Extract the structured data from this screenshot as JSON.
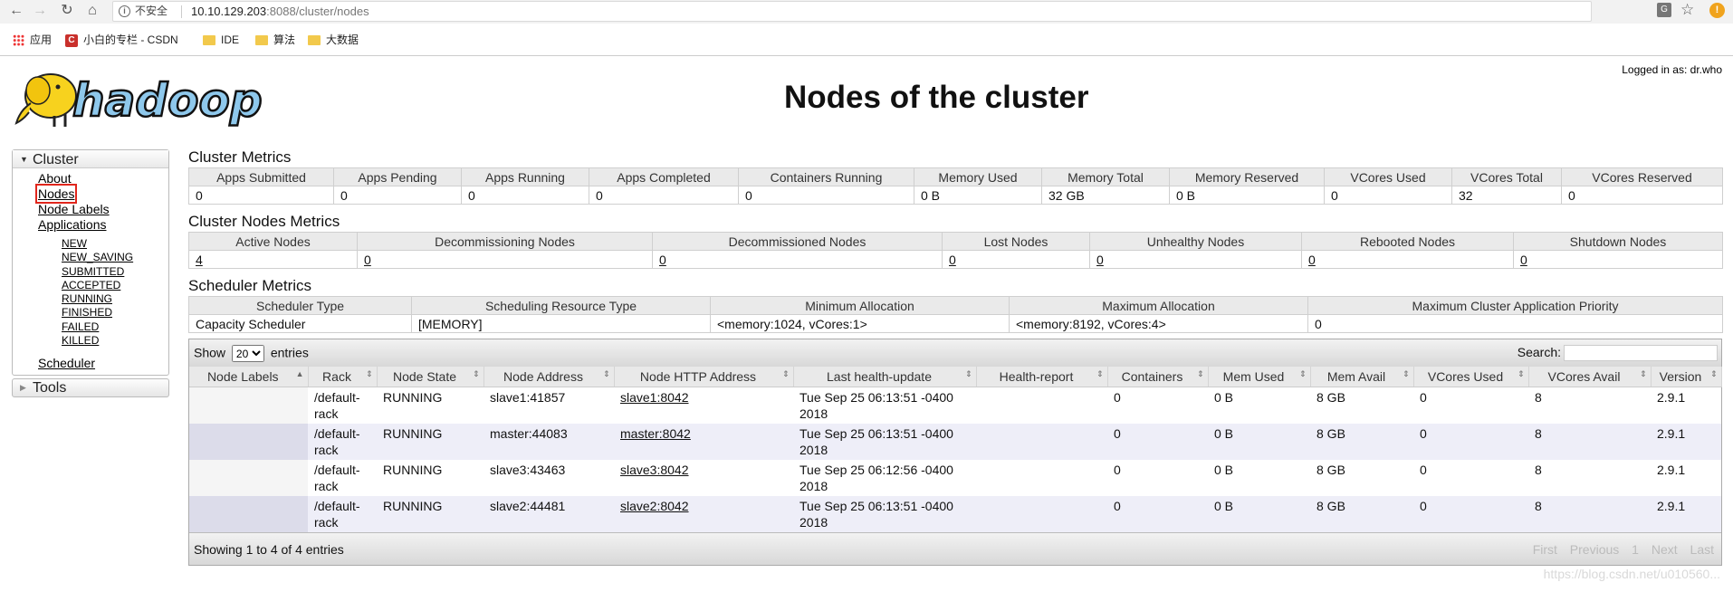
{
  "browser": {
    "security_label": "不安全",
    "url_host": "10.10.129.203",
    "url_rest": ":8088/cluster/nodes",
    "bookmarks": [
      "应用",
      "小白的专栏 - CSDN",
      "IDE",
      "算法",
      "大数据"
    ]
  },
  "header": {
    "logo_text": "hadoop",
    "logged_in": "Logged in as: dr.who",
    "title": "Nodes of the cluster"
  },
  "sidebar": {
    "cluster_label": "Cluster",
    "links": [
      "About",
      "Nodes",
      "Node Labels",
      "Applications"
    ],
    "app_states": [
      "NEW",
      "NEW_SAVING",
      "SUBMITTED",
      "ACCEPTED",
      "RUNNING",
      "FINISHED",
      "FAILED",
      "KILLED"
    ],
    "scheduler": "Scheduler",
    "tools_label": "Tools"
  },
  "cluster_metrics": {
    "title": "Cluster Metrics",
    "headers": [
      "Apps Submitted",
      "Apps Pending",
      "Apps Running",
      "Apps Completed",
      "Containers Running",
      "Memory Used",
      "Memory Total",
      "Memory Reserved",
      "VCores Used",
      "VCores Total",
      "VCores Reserved"
    ],
    "values": [
      "0",
      "0",
      "0",
      "0",
      "0",
      "0 B",
      "32 GB",
      "0 B",
      "0",
      "32",
      "0"
    ]
  },
  "node_metrics": {
    "title": "Cluster Nodes Metrics",
    "headers": [
      "Active Nodes",
      "Decommissioning Nodes",
      "Decommissioned Nodes",
      "Lost Nodes",
      "Unhealthy Nodes",
      "Rebooted Nodes",
      "Shutdown Nodes"
    ],
    "values": [
      "4",
      "0",
      "0",
      "0",
      "0",
      "0",
      "0"
    ]
  },
  "scheduler_metrics": {
    "title": "Scheduler Metrics",
    "headers": [
      "Scheduler Type",
      "Scheduling Resource Type",
      "Minimum Allocation",
      "Maximum Allocation",
      "Maximum Cluster Application Priority"
    ],
    "values": [
      "Capacity Scheduler",
      "[MEMORY]",
      "<memory:1024, vCores:1>",
      "<memory:8192, vCores:4>",
      "0"
    ]
  },
  "nodes_table": {
    "show_label": "Show",
    "entries_value": "20",
    "entries_label": "entries",
    "search_label": "Search:",
    "headers": [
      "Node Labels",
      "Rack",
      "Node State",
      "Node Address",
      "Node HTTP Address",
      "Last health-update",
      "Health-report",
      "Containers",
      "Mem Used",
      "Mem Avail",
      "VCores Used",
      "VCores Avail",
      "Version"
    ],
    "rows": [
      {
        "label": "",
        "rack": "/default-rack",
        "state": "RUNNING",
        "address": "slave1:41857",
        "http": "slave1:8042",
        "health_update": "Tue Sep 25 06:13:51 -0400 2018",
        "health_report": "",
        "containers": "0",
        "mem_used": "0 B",
        "mem_avail": "8 GB",
        "vcores_used": "0",
        "vcores_avail": "8",
        "version": "2.9.1"
      },
      {
        "label": "",
        "rack": "/default-rack",
        "state": "RUNNING",
        "address": "master:44083",
        "http": "master:8042",
        "health_update": "Tue Sep 25 06:13:51 -0400 2018",
        "health_report": "",
        "containers": "0",
        "mem_used": "0 B",
        "mem_avail": "8 GB",
        "vcores_used": "0",
        "vcores_avail": "8",
        "version": "2.9.1"
      },
      {
        "label": "",
        "rack": "/default-rack",
        "state": "RUNNING",
        "address": "slave3:43463",
        "http": "slave3:8042",
        "health_update": "Tue Sep 25 06:12:56 -0400 2018",
        "health_report": "",
        "containers": "0",
        "mem_used": "0 B",
        "mem_avail": "8 GB",
        "vcores_used": "0",
        "vcores_avail": "8",
        "version": "2.9.1"
      },
      {
        "label": "",
        "rack": "/default-rack",
        "state": "RUNNING",
        "address": "slave2:44481",
        "http": "slave2:8042",
        "health_update": "Tue Sep 25 06:13:51 -0400 2018",
        "health_report": "",
        "containers": "0",
        "mem_used": "0 B",
        "mem_avail": "8 GB",
        "vcores_used": "0",
        "vcores_avail": "8",
        "version": "2.9.1"
      }
    ],
    "info": "Showing 1 to 4 of 4 entries",
    "pager": [
      "First",
      "Previous",
      "1",
      "Next",
      "Last"
    ]
  },
  "watermark": "https://blog.csdn.net/u010560..."
}
